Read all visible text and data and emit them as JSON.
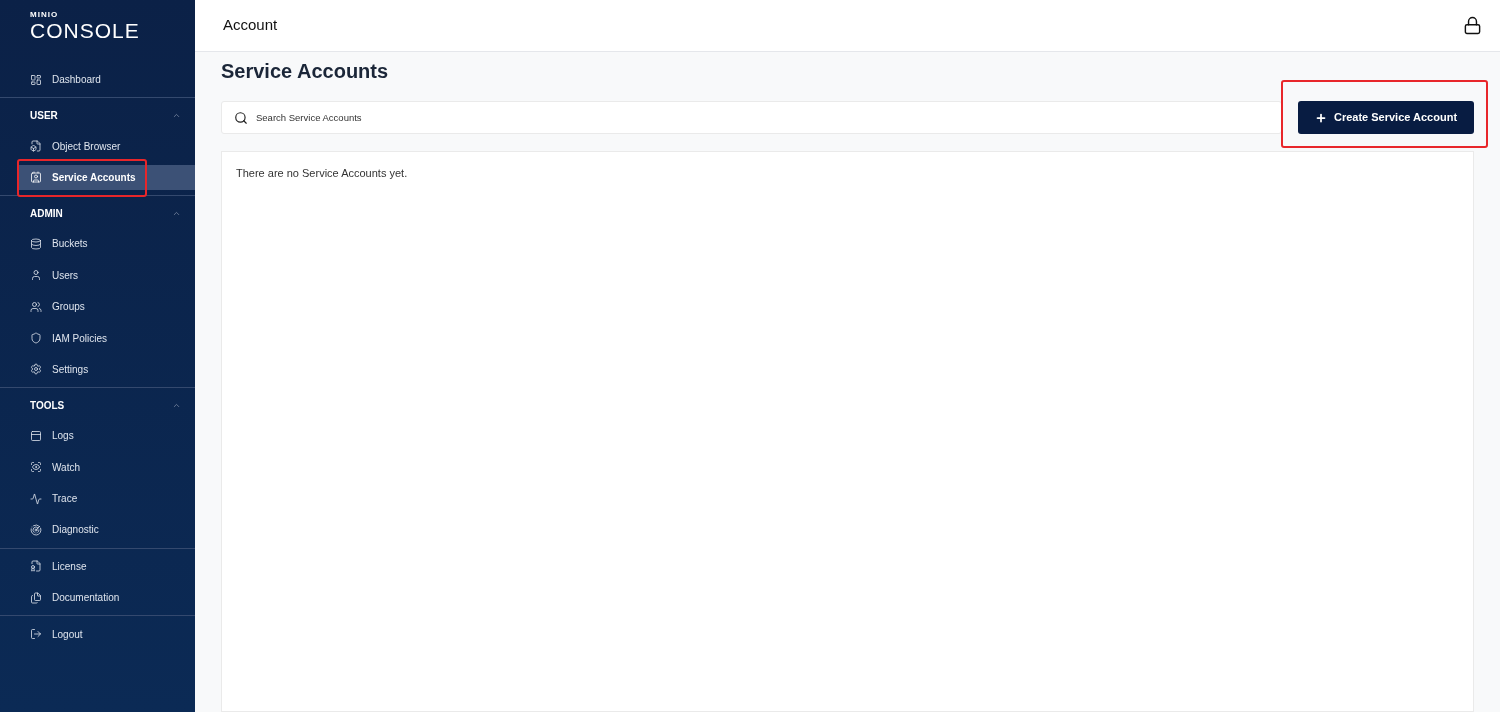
{
  "logo": {
    "brand": "MINIO",
    "product": "CONSOLE"
  },
  "sidebar": {
    "sections": [
      {
        "items": [
          {
            "label": "Dashboard",
            "selected": false,
            "annotated": false
          }
        ]
      },
      {
        "title": "USER",
        "expanded": true,
        "items": [
          {
            "label": "Object Browser",
            "selected": false,
            "annotated": false
          },
          {
            "label": "Service Accounts",
            "selected": true,
            "annotated": true
          }
        ]
      },
      {
        "title": "ADMIN",
        "expanded": true,
        "items": [
          {
            "label": "Buckets",
            "selected": false,
            "annotated": false
          },
          {
            "label": "Users",
            "selected": false,
            "annotated": false
          },
          {
            "label": "Groups",
            "selected": false,
            "annotated": false
          },
          {
            "label": "IAM Policies",
            "selected": false,
            "annotated": false
          },
          {
            "label": "Settings",
            "selected": false,
            "annotated": false
          }
        ]
      },
      {
        "title": "TOOLS",
        "expanded": true,
        "items": [
          {
            "label": "Logs",
            "selected": false,
            "annotated": false
          },
          {
            "label": "Watch",
            "selected": false,
            "annotated": false
          },
          {
            "label": "Trace",
            "selected": false,
            "annotated": false
          },
          {
            "label": "Diagnostic",
            "selected": false,
            "annotated": false
          }
        ]
      },
      {
        "items": [
          {
            "label": "License",
            "selected": false,
            "annotated": false
          },
          {
            "label": "Documentation",
            "selected": false,
            "annotated": false
          }
        ]
      },
      {
        "items": [
          {
            "label": "Logout",
            "selected": false,
            "annotated": false
          }
        ]
      }
    ]
  },
  "header": {
    "title": "Account"
  },
  "page": {
    "title": "Service Accounts",
    "search": {
      "placeholder": "Search Service Accounts"
    },
    "create_button": {
      "label": "Create Service Account",
      "annotated": true
    },
    "empty_message": "There are no Service Accounts yet."
  }
}
